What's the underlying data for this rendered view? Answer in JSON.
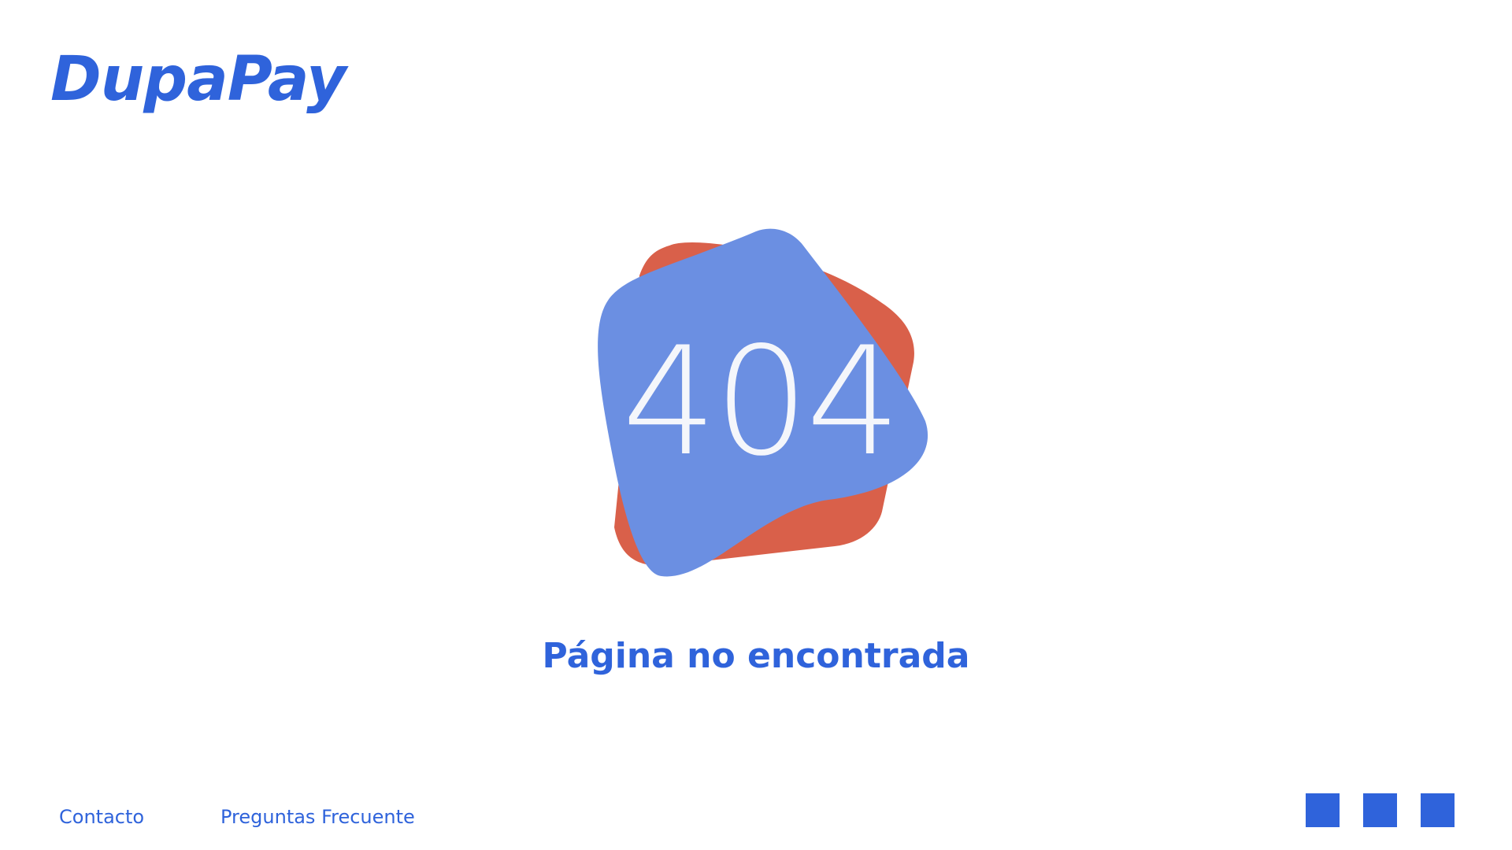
{
  "brand": {
    "name": "DupaPay",
    "color": "#2f63db"
  },
  "error": {
    "code": "404",
    "message": "Página no encontrada",
    "blob_back_color": "#d9604a",
    "blob_front_color": "#6b8fe2"
  },
  "footer": {
    "links": [
      {
        "label": "Contacto"
      },
      {
        "label": "Preguntas Frecuente"
      }
    ],
    "social_icons": [
      "social-icon-1",
      "social-icon-2",
      "social-icon-3"
    ]
  }
}
